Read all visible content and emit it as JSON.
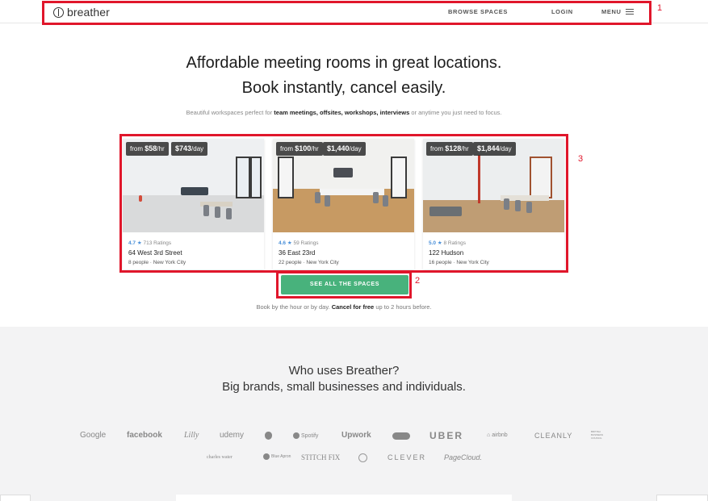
{
  "header": {
    "logo_text": "breather",
    "nav_browse": "BROWSE SPACES",
    "nav_login": "LOGIN",
    "nav_menu": "MENU"
  },
  "hero": {
    "title_line1": "Affordable meeting rooms in great locations.",
    "title_line2": "Book instantly, cancel easily.",
    "subtitle_prefix": "Beautiful workspaces perfect for",
    "subtitle_bold": "team meetings, offsites, workshops, interviews",
    "subtitle_suffix": "or anytime you just need to focus."
  },
  "cards": [
    {
      "price_hour_prefix": "from",
      "price_hour": "$58",
      "price_hour_unit": "/hr",
      "price_day": "$743",
      "price_day_unit": "/day",
      "rating": "4.7 ★",
      "ratings_count": "713 Ratings",
      "name": "64 West 3rd Street",
      "meta": "8 people · New York City"
    },
    {
      "price_hour_prefix": "from",
      "price_hour": "$100",
      "price_hour_unit": "/hr",
      "price_day": "$1,440",
      "price_day_unit": "/day",
      "rating": "4.6 ★",
      "ratings_count": "59 Ratings",
      "name": "36 East 23rd",
      "meta": "22 people · New York City"
    },
    {
      "price_hour_prefix": "from",
      "price_hour": "$128",
      "price_hour_unit": "/hr",
      "price_day": "$1,844",
      "price_day_unit": "/day",
      "rating": "5.0 ★",
      "ratings_count": "8 Ratings",
      "name": "122 Hudson",
      "meta": "16 people · New York City"
    }
  ],
  "cta": {
    "label": "SEE ALL THE SPACES",
    "note_prefix": "Book by the hour or by day.",
    "note_bold": "Cancel for free",
    "note_suffix": "up to 2 hours before."
  },
  "who": {
    "title_line1": "Who uses Breather?",
    "title_line2": "Big brands, small businesses and individuals."
  },
  "brands_row1": [
    "Google",
    "facebook",
    "Lilly",
    "udemy",
    "",
    "Spotify",
    "Upwork",
    "",
    "UBER",
    "airbnb",
    "CLEANLY",
    "BRITISH BUSINESS COUNCIL"
  ],
  "brands_row2": [
    "charles water",
    "Blue Apron",
    "STITCH FIX",
    "",
    "CLEVER",
    "PageCloud."
  ],
  "annotations": [
    "1",
    "2",
    "3"
  ],
  "colors": {
    "accent_green": "#48b27c",
    "rating_blue": "#4a90d9",
    "annotation_red": "#e0162b"
  }
}
